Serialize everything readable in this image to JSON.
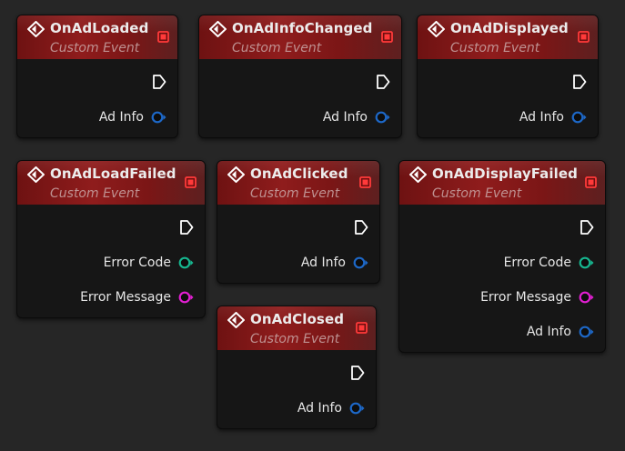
{
  "colors": {
    "header_red": "#8f1c1c",
    "delegate_pin": "#ff3a3a",
    "struct_pin": "#1d68c8",
    "int_pin": "#16b68f",
    "string_pin": "#e21fd2",
    "background": "#262626"
  },
  "icons": {
    "event": "event-diamond-icon",
    "delegate": "delegate-square-icon",
    "exec": "exec-arrow-pin-icon"
  },
  "nodes": [
    {
      "title": "OnAdLoaded",
      "subtitle": "Custom Event",
      "pins": [
        {
          "label": "Ad Info",
          "type": "struct"
        }
      ]
    },
    {
      "title": "OnAdInfoChanged",
      "subtitle": "Custom Event",
      "pins": [
        {
          "label": "Ad Info",
          "type": "struct"
        }
      ]
    },
    {
      "title": "OnAdDisplayed",
      "subtitle": "Custom Event",
      "pins": [
        {
          "label": "Ad Info",
          "type": "struct"
        }
      ]
    },
    {
      "title": "OnAdLoadFailed",
      "subtitle": "Custom Event",
      "pins": [
        {
          "label": "Error Code",
          "type": "int"
        },
        {
          "label": "Error Message",
          "type": "string"
        }
      ]
    },
    {
      "title": "OnAdClicked",
      "subtitle": "Custom Event",
      "pins": [
        {
          "label": "Ad Info",
          "type": "struct"
        }
      ]
    },
    {
      "title": "OnAdDisplayFailed",
      "subtitle": "Custom Event",
      "pins": [
        {
          "label": "Error Code",
          "type": "int"
        },
        {
          "label": "Error Message",
          "type": "string"
        },
        {
          "label": "Ad Info",
          "type": "struct"
        }
      ]
    },
    {
      "title": "OnAdClosed",
      "subtitle": "Custom Event",
      "pins": [
        {
          "label": "Ad Info",
          "type": "struct"
        }
      ]
    }
  ]
}
